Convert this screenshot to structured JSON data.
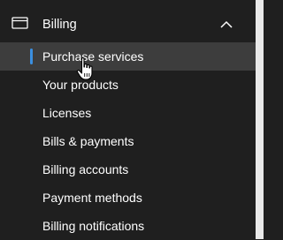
{
  "nav": {
    "group": {
      "label": "Billing",
      "icon": "billing-card-icon",
      "expand_icon": "chevron-up-icon"
    },
    "items": [
      {
        "label": "Purchase services",
        "selected": true
      },
      {
        "label": "Your products",
        "selected": false
      },
      {
        "label": "Licenses",
        "selected": false
      },
      {
        "label": "Bills & payments",
        "selected": false
      },
      {
        "label": "Billing accounts",
        "selected": false
      },
      {
        "label": "Payment methods",
        "selected": false
      },
      {
        "label": "Billing notifications",
        "selected": false
      }
    ]
  },
  "colors": {
    "background": "#1f1f1f",
    "selected_background": "#3d3d3d",
    "accent": "#3b8fe0",
    "text": "#ffffff",
    "scrollbar_gutter": "#e9e9e9"
  },
  "pointer": {
    "icon": "hand-pointer-icon"
  }
}
